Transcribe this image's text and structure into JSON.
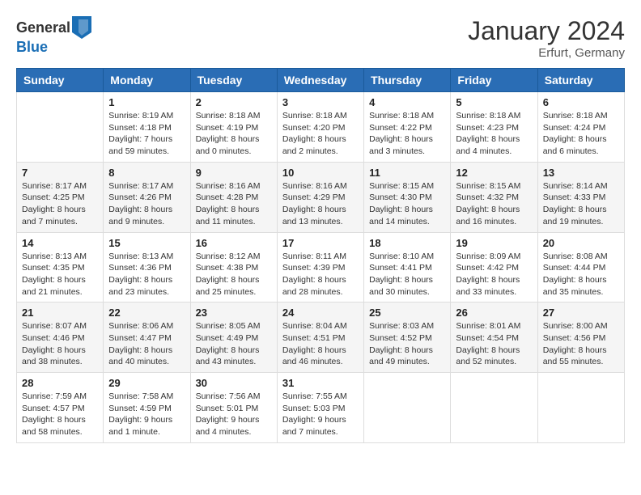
{
  "logo": {
    "general": "General",
    "blue": "Blue"
  },
  "title": {
    "month_year": "January 2024",
    "location": "Erfurt, Germany"
  },
  "headers": [
    "Sunday",
    "Monday",
    "Tuesday",
    "Wednesday",
    "Thursday",
    "Friday",
    "Saturday"
  ],
  "weeks": [
    [
      {
        "day": "",
        "info": ""
      },
      {
        "day": "1",
        "info": "Sunrise: 8:19 AM\nSunset: 4:18 PM\nDaylight: 7 hours\nand 59 minutes."
      },
      {
        "day": "2",
        "info": "Sunrise: 8:18 AM\nSunset: 4:19 PM\nDaylight: 8 hours\nand 0 minutes."
      },
      {
        "day": "3",
        "info": "Sunrise: 8:18 AM\nSunset: 4:20 PM\nDaylight: 8 hours\nand 2 minutes."
      },
      {
        "day": "4",
        "info": "Sunrise: 8:18 AM\nSunset: 4:22 PM\nDaylight: 8 hours\nand 3 minutes."
      },
      {
        "day": "5",
        "info": "Sunrise: 8:18 AM\nSunset: 4:23 PM\nDaylight: 8 hours\nand 4 minutes."
      },
      {
        "day": "6",
        "info": "Sunrise: 8:18 AM\nSunset: 4:24 PM\nDaylight: 8 hours\nand 6 minutes."
      }
    ],
    [
      {
        "day": "7",
        "info": "Sunrise: 8:17 AM\nSunset: 4:25 PM\nDaylight: 8 hours\nand 7 minutes."
      },
      {
        "day": "8",
        "info": "Sunrise: 8:17 AM\nSunset: 4:26 PM\nDaylight: 8 hours\nand 9 minutes."
      },
      {
        "day": "9",
        "info": "Sunrise: 8:16 AM\nSunset: 4:28 PM\nDaylight: 8 hours\nand 11 minutes."
      },
      {
        "day": "10",
        "info": "Sunrise: 8:16 AM\nSunset: 4:29 PM\nDaylight: 8 hours\nand 13 minutes."
      },
      {
        "day": "11",
        "info": "Sunrise: 8:15 AM\nSunset: 4:30 PM\nDaylight: 8 hours\nand 14 minutes."
      },
      {
        "day": "12",
        "info": "Sunrise: 8:15 AM\nSunset: 4:32 PM\nDaylight: 8 hours\nand 16 minutes."
      },
      {
        "day": "13",
        "info": "Sunrise: 8:14 AM\nSunset: 4:33 PM\nDaylight: 8 hours\nand 19 minutes."
      }
    ],
    [
      {
        "day": "14",
        "info": "Sunrise: 8:13 AM\nSunset: 4:35 PM\nDaylight: 8 hours\nand 21 minutes."
      },
      {
        "day": "15",
        "info": "Sunrise: 8:13 AM\nSunset: 4:36 PM\nDaylight: 8 hours\nand 23 minutes."
      },
      {
        "day": "16",
        "info": "Sunrise: 8:12 AM\nSunset: 4:38 PM\nDaylight: 8 hours\nand 25 minutes."
      },
      {
        "day": "17",
        "info": "Sunrise: 8:11 AM\nSunset: 4:39 PM\nDaylight: 8 hours\nand 28 minutes."
      },
      {
        "day": "18",
        "info": "Sunrise: 8:10 AM\nSunset: 4:41 PM\nDaylight: 8 hours\nand 30 minutes."
      },
      {
        "day": "19",
        "info": "Sunrise: 8:09 AM\nSunset: 4:42 PM\nDaylight: 8 hours\nand 33 minutes."
      },
      {
        "day": "20",
        "info": "Sunrise: 8:08 AM\nSunset: 4:44 PM\nDaylight: 8 hours\nand 35 minutes."
      }
    ],
    [
      {
        "day": "21",
        "info": "Sunrise: 8:07 AM\nSunset: 4:46 PM\nDaylight: 8 hours\nand 38 minutes."
      },
      {
        "day": "22",
        "info": "Sunrise: 8:06 AM\nSunset: 4:47 PM\nDaylight: 8 hours\nand 40 minutes."
      },
      {
        "day": "23",
        "info": "Sunrise: 8:05 AM\nSunset: 4:49 PM\nDaylight: 8 hours\nand 43 minutes."
      },
      {
        "day": "24",
        "info": "Sunrise: 8:04 AM\nSunset: 4:51 PM\nDaylight: 8 hours\nand 46 minutes."
      },
      {
        "day": "25",
        "info": "Sunrise: 8:03 AM\nSunset: 4:52 PM\nDaylight: 8 hours\nand 49 minutes."
      },
      {
        "day": "26",
        "info": "Sunrise: 8:01 AM\nSunset: 4:54 PM\nDaylight: 8 hours\nand 52 minutes."
      },
      {
        "day": "27",
        "info": "Sunrise: 8:00 AM\nSunset: 4:56 PM\nDaylight: 8 hours\nand 55 minutes."
      }
    ],
    [
      {
        "day": "28",
        "info": "Sunrise: 7:59 AM\nSunset: 4:57 PM\nDaylight: 8 hours\nand 58 minutes."
      },
      {
        "day": "29",
        "info": "Sunrise: 7:58 AM\nSunset: 4:59 PM\nDaylight: 9 hours\nand 1 minute."
      },
      {
        "day": "30",
        "info": "Sunrise: 7:56 AM\nSunset: 5:01 PM\nDaylight: 9 hours\nand 4 minutes."
      },
      {
        "day": "31",
        "info": "Sunrise: 7:55 AM\nSunset: 5:03 PM\nDaylight: 9 hours\nand 7 minutes."
      },
      {
        "day": "",
        "info": ""
      },
      {
        "day": "",
        "info": ""
      },
      {
        "day": "",
        "info": ""
      }
    ]
  ]
}
